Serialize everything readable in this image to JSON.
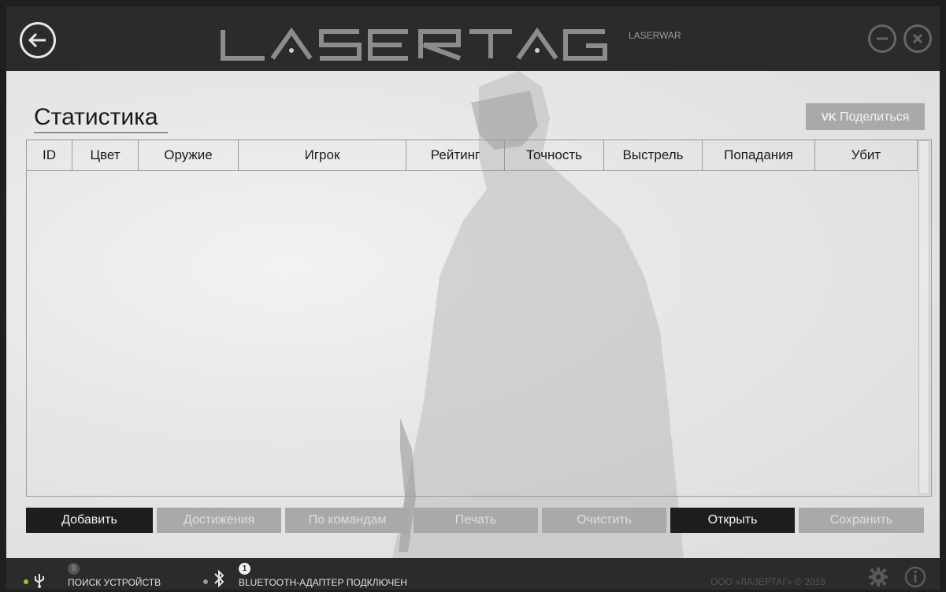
{
  "header": {
    "logo_text": "LASERTAG",
    "logo_sub": "LASERWAR"
  },
  "page": {
    "title": "Статистика",
    "share_label": "Поделиться",
    "share_icon": "vk-icon"
  },
  "table": {
    "columns": [
      "ID",
      "Цвет",
      "Оружие",
      "Игрок",
      "Рейтинг",
      "Точность",
      "Выстрель",
      "Попадания",
      "Убит"
    ],
    "rows": []
  },
  "buttons": {
    "add": "Добавить",
    "achievements": "Достижения",
    "by_teams": "По командам",
    "print": "Печать",
    "clear": "Очистить",
    "open": "Открыть",
    "save": "Сохранить"
  },
  "status": {
    "usb_label": "ПОИСК УСТРОЙСТВ",
    "usb_count": "0",
    "bt_label": "BLUETOOTH-АДАПТЕР ПОДКЛЮЧЕН",
    "bt_count": "1",
    "copyright": "ООО «ЛАЗЕРТАГ» © 2015"
  },
  "colors": {
    "usb_dot": "#7ed321",
    "bt_dot": "#9a9a9a",
    "dark_button": "#1e1e1e",
    "light_button": "#a9a9a9"
  }
}
